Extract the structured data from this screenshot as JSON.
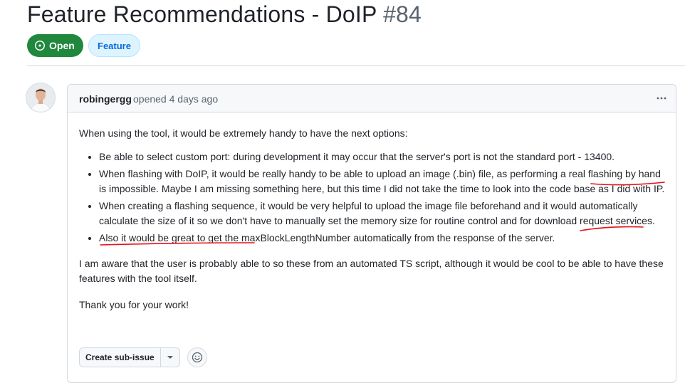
{
  "issue": {
    "title": "Feature Recommendations - DoIP",
    "number": "#84",
    "state": "Open",
    "labels": [
      "Feature"
    ]
  },
  "comment": {
    "author": "robingergg",
    "action": "opened 4 days ago",
    "intro": "When using the tool, it would be extremely handy to have the next options:",
    "bullets": [
      "Be able to select custom port: during development it may occur that the server's port is not the standard port - 13400.",
      "When flashing with DoIP, it would be really handy to be able to upload an image (.bin) file, as performing a real flashing by hand is impossible. Maybe I am missing something here, but this time I did not take the time to look into the code base as I did with IP.",
      "When creating a flashing sequence, it would be very helpful to upload the image file beforehand and it would automatically calculate the size of it so we don't have to manually set the memory size for routine control and for download request services.",
      "Also it would be great to get the maxBlockLengthNumber automatically from the response of the server."
    ],
    "paragraph2": "I am aware that the user is probably able to so these from an automated TS script, although it would be cool to be able to have these features with the tool itself.",
    "paragraph3": "Thank you for your work!"
  },
  "actions": {
    "create_sub_issue": "Create sub-issue"
  },
  "colors": {
    "open_green": "#1f883d",
    "label_blue": "#0969da",
    "annotation_red": "#e5121b"
  },
  "icons": {
    "state": "issue-opened-icon",
    "menu": "kebab-horizontal-icon",
    "dropdown": "triangle-down-icon",
    "reaction": "smiley-icon"
  }
}
